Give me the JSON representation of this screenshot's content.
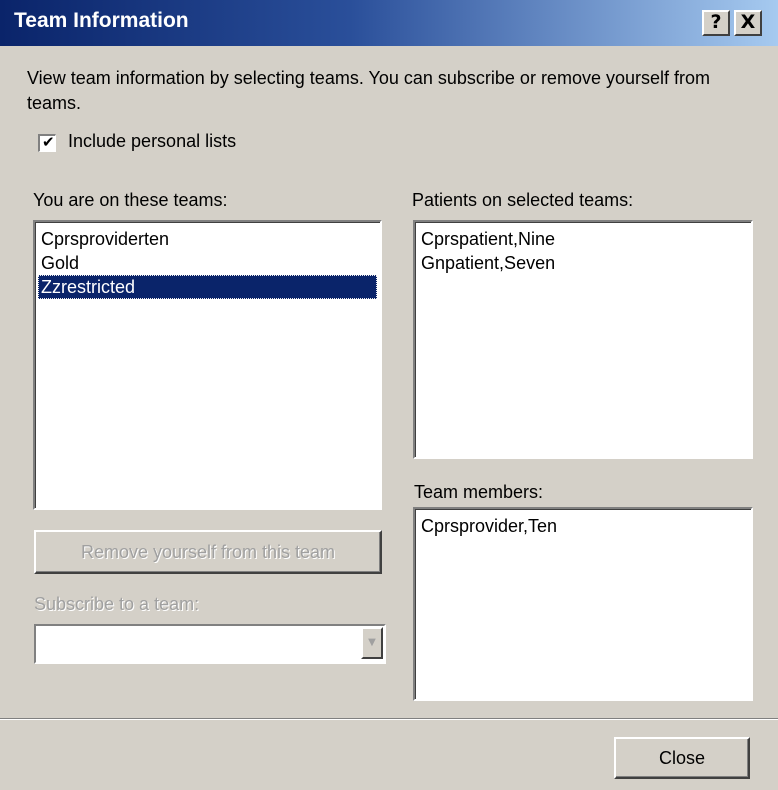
{
  "window": {
    "title": "Team Information",
    "help_glyph": "?",
    "close_glyph": "X"
  },
  "intro_text": "View team information by selecting teams. You can subscribe or remove yourself from teams.",
  "include_personal_lists": {
    "label": "Include personal lists",
    "checked": true,
    "mark": "✔"
  },
  "teams": {
    "label": "You are on these teams:",
    "items": [
      "Cprsproviderten",
      "Gold",
      "Zzrestricted"
    ],
    "selected_index": 2
  },
  "patients": {
    "label": "Patients on selected teams:",
    "items": [
      "Cprspatient,Nine",
      "Gnpatient,Seven"
    ]
  },
  "team_members": {
    "label": "Team members:",
    "items": [
      "Cprsprovider,Ten"
    ]
  },
  "remove_button": {
    "label": "Remove yourself from this team",
    "enabled": false
  },
  "subscribe": {
    "label": "Subscribe to a team:",
    "value": "",
    "enabled": false,
    "arrow_glyph": "▼"
  },
  "close_button": {
    "label": "Close"
  }
}
